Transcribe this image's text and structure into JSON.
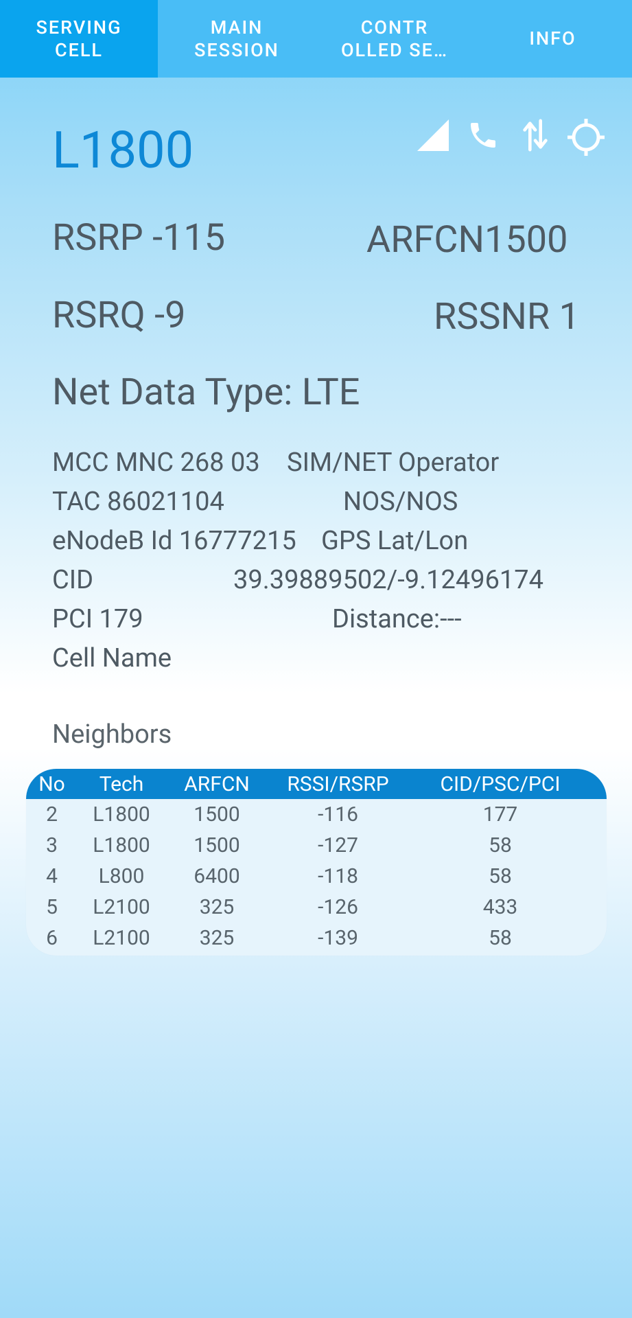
{
  "tabs": [
    {
      "label": "SERVING\nCELL"
    },
    {
      "label": "MAIN\nSESSION"
    },
    {
      "label": "CONTR\nOLLED SE…"
    },
    {
      "label": "INFO"
    }
  ],
  "serving": {
    "tech": "L1800",
    "rsrp_label": "RSRP",
    "rsrp_value": "-115",
    "arfcn_label": "ARFCN",
    "arfcn_value": "1500",
    "rsrq_label": "RSRQ",
    "rsrq_value": "-9",
    "rssnr_label": "RSSNR",
    "rssnr_value": "1",
    "net_label": "Net Data Type:",
    "net_value": "LTE",
    "mccmnc_label": "MCC MNC",
    "mccmnc_value": "268 03",
    "operator_label": "SIM/NET Operator",
    "tac_label": "TAC",
    "tac_value": "86021104",
    "operator_value": "NOS/NOS",
    "enodeb_label": "eNodeB Id",
    "enodeb_value": "16777215",
    "gps_label": "GPS Lat/Lon",
    "cid_label": "CID",
    "gps_value": "39.39889502/-9.12496174",
    "pci_label": "PCI",
    "pci_value": "179",
    "distance_label": "Distance:",
    "distance_value": "---",
    "cellname_label": "Cell Name"
  },
  "icons": [
    "signal-icon",
    "phone-icon",
    "data-transfer-icon",
    "gps-icon"
  ],
  "neighbors": {
    "title": "Neighbors",
    "headers": [
      "No",
      "Tech",
      "ARFCN",
      "RSSI/RSRP",
      "CID/PSC/PCI"
    ],
    "rows": [
      [
        "2",
        "L1800",
        "1500",
        "-116",
        "177"
      ],
      [
        "3",
        "L1800",
        "1500",
        "-127",
        "58"
      ],
      [
        "4",
        "L800",
        "6400",
        "-118",
        "58"
      ],
      [
        "5",
        "L2100",
        "325",
        "-126",
        "433"
      ],
      [
        "6",
        "L2100",
        "325",
        "-139",
        "58"
      ]
    ]
  },
  "colors": {
    "tab_bar": "#49bdf6",
    "tab_active": "#0aa4ee",
    "tech": "#0e88d6",
    "table_header": "#0a84cf"
  }
}
